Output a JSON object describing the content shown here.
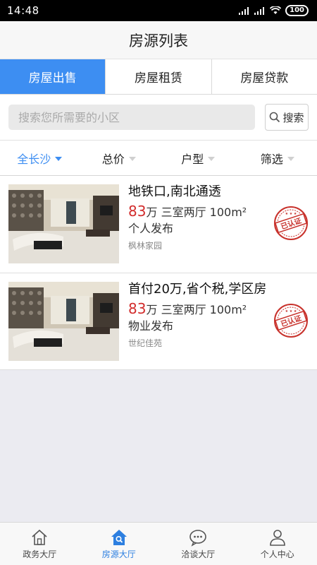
{
  "status": {
    "time": "14:48",
    "battery": "100"
  },
  "header": {
    "title": "房源列表"
  },
  "tabs": [
    {
      "label": "房屋出售",
      "active": true
    },
    {
      "label": "房屋租赁",
      "active": false
    },
    {
      "label": "房屋贷款",
      "active": false
    }
  ],
  "search": {
    "placeholder": "搜索您所需要的小区",
    "button_label": "搜索"
  },
  "filters": [
    {
      "label": "全长沙",
      "active": true
    },
    {
      "label": "总价",
      "active": false
    },
    {
      "label": "户型",
      "active": false
    },
    {
      "label": "筛选",
      "active": false
    }
  ],
  "listings": [
    {
      "title": "地铁口,南北通透",
      "price": "83",
      "price_unit": "万",
      "specs": "三室两厅 100m²",
      "publisher": "个人发布",
      "community": "枫林家园",
      "stamp": "已认证"
    },
    {
      "title": "首付20万,省个税,学区房",
      "price": "83",
      "price_unit": "万",
      "specs": "三室两厅 100m²",
      "publisher": "物业发布",
      "community": "世纪佳苑",
      "stamp": "已认证"
    }
  ],
  "nav": [
    {
      "label": "政务大厅",
      "icon": "home-outline-icon",
      "active": false
    },
    {
      "label": "房源大厅",
      "icon": "house-search-icon",
      "active": true
    },
    {
      "label": "洽谈大厅",
      "icon": "chat-bubble-icon",
      "active": false
    },
    {
      "label": "个人中心",
      "icon": "person-icon",
      "active": false
    }
  ],
  "colors": {
    "accent": "#3d8ef2",
    "price": "#d22c2c",
    "stamp": "#c8322c"
  }
}
